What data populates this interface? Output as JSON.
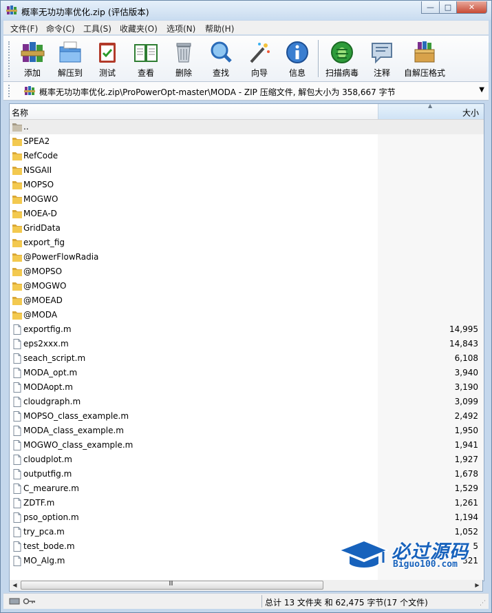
{
  "window": {
    "title": "概率无功功率优化.zip (评估版本)",
    "buttons": {
      "minimize": "—",
      "maximize": "□",
      "close": "✕"
    }
  },
  "menu": [
    "文件(F)",
    "命令(C)",
    "工具(S)",
    "收藏夹(O)",
    "选项(N)",
    "帮助(H)"
  ],
  "toolbar": [
    {
      "label": "添加",
      "icon": "add-books-icon"
    },
    {
      "label": "解压到",
      "icon": "extract-folder-icon"
    },
    {
      "label": "测试",
      "icon": "test-clipboard-icon"
    },
    {
      "label": "查看",
      "icon": "view-book-icon"
    },
    {
      "label": "删除",
      "icon": "trash-icon"
    },
    {
      "label": "查找",
      "icon": "find-magnifier-icon"
    },
    {
      "label": "向导",
      "icon": "wizard-wand-icon"
    },
    {
      "label": "信息",
      "icon": "info-icon"
    },
    {
      "label": "扫描病毒",
      "icon": "virus-scan-icon"
    },
    {
      "label": "注释",
      "icon": "comment-icon"
    },
    {
      "label": "自解压格式",
      "icon": "sfx-box-icon"
    }
  ],
  "address": {
    "path": "概率无功功率优化.zip\\ProPowerOpt-master\\MODA - ZIP 压缩文件, 解包大小为 358,667 字节",
    "dropdown": "▼"
  },
  "columns": {
    "name": "名称",
    "size": "大小",
    "sort_arrow": "▲"
  },
  "files": [
    {
      "name": "..",
      "size": "",
      "type": "parent"
    },
    {
      "name": "SPEA2",
      "size": "",
      "type": "folder"
    },
    {
      "name": "RefCode",
      "size": "",
      "type": "folder"
    },
    {
      "name": "NSGAII",
      "size": "",
      "type": "folder"
    },
    {
      "name": "MOPSO",
      "size": "",
      "type": "folder"
    },
    {
      "name": "MOGWO",
      "size": "",
      "type": "folder"
    },
    {
      "name": "MOEA-D",
      "size": "",
      "type": "folder"
    },
    {
      "name": "GridData",
      "size": "",
      "type": "folder"
    },
    {
      "name": "export_fig",
      "size": "",
      "type": "folder"
    },
    {
      "name": "@PowerFlowRadia",
      "size": "",
      "type": "folder"
    },
    {
      "name": "@MOPSO",
      "size": "",
      "type": "folder"
    },
    {
      "name": "@MOGWO",
      "size": "",
      "type": "folder"
    },
    {
      "name": "@MOEAD",
      "size": "",
      "type": "folder"
    },
    {
      "name": "@MODA",
      "size": "",
      "type": "folder"
    },
    {
      "name": "exportfig.m",
      "size": "14,995",
      "type": "file"
    },
    {
      "name": "eps2xxx.m",
      "size": "14,843",
      "type": "file"
    },
    {
      "name": "seach_script.m",
      "size": "6,108",
      "type": "file"
    },
    {
      "name": "MODA_opt.m",
      "size": "3,940",
      "type": "file"
    },
    {
      "name": "MODAopt.m",
      "size": "3,190",
      "type": "file"
    },
    {
      "name": "cloudgraph.m",
      "size": "3,099",
      "type": "file"
    },
    {
      "name": "MOPSO_class_example.m",
      "size": "2,492",
      "type": "file"
    },
    {
      "name": "MODA_class_example.m",
      "size": "1,950",
      "type": "file"
    },
    {
      "name": "MOGWO_class_example.m",
      "size": "1,941",
      "type": "file"
    },
    {
      "name": "cloudplot.m",
      "size": "1,927",
      "type": "file"
    },
    {
      "name": "outputfig.m",
      "size": "1,678",
      "type": "file"
    },
    {
      "name": "C_mearure.m",
      "size": "1,529",
      "type": "file"
    },
    {
      "name": "ZDTF.m",
      "size": "1,261",
      "type": "file"
    },
    {
      "name": "pso_option.m",
      "size": "1,194",
      "type": "file"
    },
    {
      "name": "try_pca.m",
      "size": "1,052",
      "type": "file"
    },
    {
      "name": "test_bode.m",
      "size": "5",
      "type": "file"
    },
    {
      "name": "MO_Alg.m",
      "size": "321",
      "type": "file"
    }
  ],
  "scrollbar": {
    "left": "◀",
    "right": "▶",
    "thumb_grip": "III"
  },
  "status": {
    "summary": "总计 13 文件夹 和 62,475 字节(17 个文件)",
    "grip": "⋰"
  },
  "watermark": {
    "cn": "必过源码",
    "en": "Biguo100.com"
  },
  "colors": {
    "folder": "#f0c24b",
    "accent": "#1762bc",
    "header_active": "#cfe3f5"
  }
}
